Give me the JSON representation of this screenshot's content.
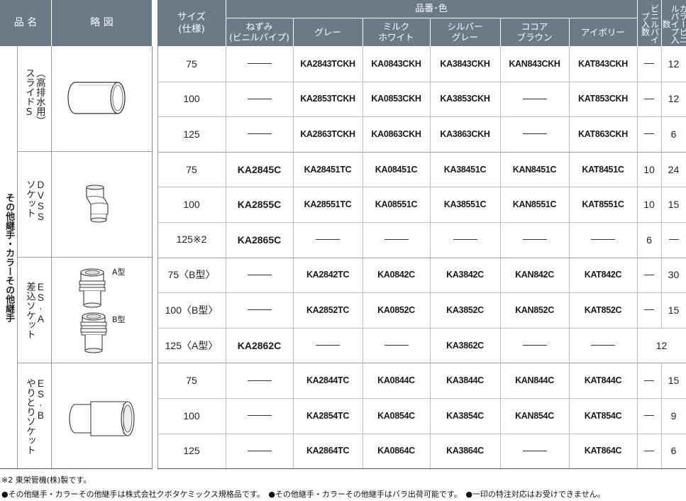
{
  "header": {
    "product_name": "品 名",
    "sketch": "略 図",
    "size": "サイズ\n(仕様)",
    "part_number_color": "品番･色",
    "colors": [
      "ねずみ\n(ビニルパイプ)",
      "グレー",
      "ミルク\nホワイト",
      "シルバー\nグレー",
      "ココア\nブラウン",
      "アイボリー"
    ],
    "vinyl_pipe_qty": "ビニルパイプ入数",
    "color_pipe_qty": "カラービニルパイプ入数"
  },
  "category": "その他継手・カラーその他継手",
  "groups": [
    {
      "name": "スライドS（高排水用）",
      "sketch_icon": "pipe-sleeve-icon",
      "rows": [
        {
          "size": "75",
          "codes": [
            "",
            "KA2843TCKH",
            "KA0843CKH",
            "KA3843CKH",
            "KAN843CKH",
            "KAT843CKH"
          ],
          "qty1": "",
          "qty2": "12"
        },
        {
          "size": "100",
          "codes": [
            "",
            "KA2853TCKH",
            "KA0853CKH",
            "KA3853CKH",
            "",
            "KAT853CKH"
          ],
          "qty1": "",
          "qty2": "12"
        },
        {
          "size": "125",
          "codes": [
            "",
            "KA2863TCKH",
            "KA0863CKH",
            "KA3863CKH",
            "",
            "KAT863CKH"
          ],
          "qty1": "",
          "qty2": "6"
        }
      ]
    },
    {
      "name": "DVSSソケット",
      "sketch_icon": "offset-socket-icon",
      "rows": [
        {
          "size": "75",
          "codes": [
            "KA2845C",
            "KA28451TC",
            "KA08451C",
            "KA38451C",
            "KAN8451C",
            "KAT8451C"
          ],
          "qty1": "10",
          "qty2": "24"
        },
        {
          "size": "100",
          "codes": [
            "KA2855C",
            "KA28551TC",
            "KA08551C",
            "KA38551C",
            "KAN8551C",
            "KAT8551C"
          ],
          "qty1": "10",
          "qty2": "15"
        },
        {
          "size": "125※2",
          "codes": [
            "KA2865C",
            "",
            "",
            "",
            "",
            ""
          ],
          "qty1": "6",
          "qty2": ""
        }
      ]
    },
    {
      "name": "ES・A差込ソケット",
      "sketch_icon": "insert-socket-icon",
      "label_a": "A型",
      "label_b": "B型",
      "rows": [
        {
          "size": "75〈B型〉",
          "codes": [
            "",
            "KA2842TC",
            "KA0842C",
            "KA3842C",
            "KAN842C",
            "KAT842C"
          ],
          "qty1": "",
          "qty2": "30"
        },
        {
          "size": "100〈B型〉",
          "codes": [
            "",
            "KA2852TC",
            "KA0852C",
            "KA3852C",
            "KAN852C",
            "KAT852C"
          ],
          "qty1": "",
          "qty2": "15"
        },
        {
          "size": "125〈A型〉",
          "codes": [
            "KA2862C",
            "",
            "",
            "KA3862C",
            "",
            ""
          ],
          "qty1": "",
          "qty2": "",
          "merged_qty": "12"
        }
      ]
    },
    {
      "name": "ES・Bやりとりソケット",
      "sketch_icon": "slip-socket-icon",
      "rows": [
        {
          "size": "75",
          "codes": [
            "",
            "KA2844TC",
            "KA0844C",
            "KA3844C",
            "KAN844C",
            "KAT844C"
          ],
          "qty1": "",
          "qty2": "15"
        },
        {
          "size": "100",
          "codes": [
            "",
            "KA2854TC",
            "KA0854C",
            "KA3854C",
            "KAN854C",
            "KAT854C"
          ],
          "qty1": "",
          "qty2": "9"
        },
        {
          "size": "125",
          "codes": [
            "",
            "KA2864TC",
            "KA0864C",
            "KA3864C",
            "",
            "KAT864C"
          ],
          "qty1": "",
          "qty2": "6"
        }
      ]
    }
  ],
  "notes": [
    "※2 東栄管機(株)製です。",
    "●その他継手・カラーその他継手は株式会社クボタケミックス規格品です。　●その他継手・カラーその他継手はバラ出荷可能です。　●一印の特注対応はお受けできません。"
  ],
  "colors": {
    "header_bg": "#6b7a87",
    "rule": "#b7bec4"
  }
}
